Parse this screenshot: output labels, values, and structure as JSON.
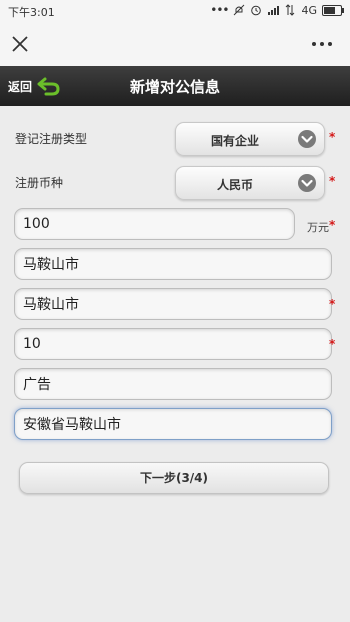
{
  "status_bar": {
    "time": "下午3:01",
    "icons": [
      "dots-icon",
      "mute-icon",
      "alarm-icon",
      "signal-icon",
      "data-icon",
      "4g-label",
      "battery-icon"
    ],
    "network": "4G"
  },
  "browser": {
    "close_icon": "close-icon",
    "more_icon": "more-dots-icon"
  },
  "header": {
    "back_label": "返回",
    "title": "新增对公信息",
    "accent_color": "#6bbf2a"
  },
  "form": {
    "register_type": {
      "label": "登记注册类型",
      "value": "国有企业",
      "required": true
    },
    "currency": {
      "label": "注册币种",
      "value": "人民币",
      "required": true
    },
    "amount": {
      "value": "100",
      "unit": "万元",
      "required": true
    },
    "field_city": {
      "value": "马鞍山市",
      "required": false
    },
    "field_city2": {
      "value": "马鞍山市",
      "required": true
    },
    "field_number": {
      "value": "10",
      "required": true
    },
    "field_industry": {
      "value": "广告",
      "required": false
    },
    "field_address": {
      "value": "安徽省马鞍山市",
      "required": false
    },
    "required_mark": "*",
    "next_label": "下一步(3/4)"
  }
}
